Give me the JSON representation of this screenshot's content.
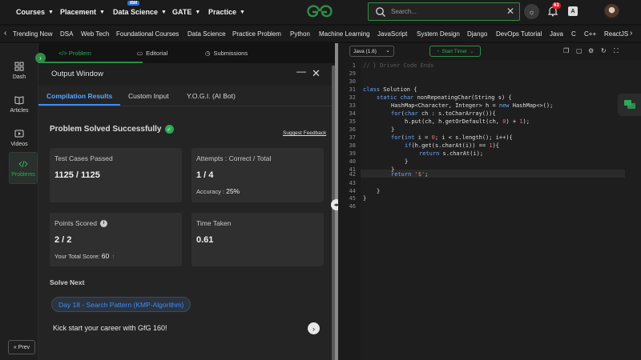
{
  "topnav": {
    "items": [
      {
        "label": "Courses"
      },
      {
        "label": "Placement"
      },
      {
        "label": "Data Science",
        "badge": "IBM"
      },
      {
        "label": "GATE"
      },
      {
        "label": "Practice"
      }
    ],
    "search_placeholder": "Search...",
    "notification_count": "63"
  },
  "subnav": {
    "items": [
      "Trending Now",
      "DSA",
      "Web Tech",
      "Foundational Courses",
      "Data Science",
      "Practice Problem",
      "Python",
      "Machine Learning",
      "JavaScript",
      "System Design",
      "Django",
      "DevOps Tutorial",
      "Java",
      "C",
      "C++",
      "ReactJS"
    ]
  },
  "sidebar": {
    "items": [
      {
        "label": "Dash"
      },
      {
        "label": "Articles"
      },
      {
        "label": "Videos"
      },
      {
        "label": "Problems",
        "active": true
      }
    ],
    "prev_label": "« Prev"
  },
  "problem_tabs": {
    "problem": "</> Problem",
    "editorial": "Editorial",
    "submissions": "Submissions"
  },
  "output": {
    "title": "Output Window",
    "tabs": [
      "Compilation Results",
      "Custom Input",
      "Y.O.G.I. (AI Bot)"
    ],
    "status": "Problem Solved Successfully",
    "feedback": "Suggest Feedback",
    "cards": {
      "test_cases": {
        "label": "Test Cases Passed",
        "value": "1125 / 1125"
      },
      "attempts": {
        "label": "Attempts : Correct / Total",
        "value": "1 / 4",
        "sub_label": "Accuracy : ",
        "sub_value": "25%"
      },
      "points": {
        "label": "Points Scored",
        "value": "2 / 2",
        "sub_label": "Your Total Score: ",
        "sub_value": "60"
      },
      "time": {
        "label": "Time Taken",
        "value": "0.61"
      }
    },
    "solve_next_title": "Solve Next",
    "solve_next_item": "Day 18 - Search Pattern (KMP-Algorithm)",
    "promo": "Kick start your career with GfG 160!"
  },
  "editor": {
    "language": "Java (1.8)",
    "timer": "Start Timer",
    "line_numbers": [
      "1",
      "29",
      "30",
      "31",
      "32",
      "33",
      "34",
      "35",
      "36",
      "37",
      "38",
      "39",
      "40",
      "41",
      "42",
      "43",
      "44",
      "45",
      "46"
    ],
    "code": {
      "l1": "// } Driver Code Ends",
      "l31a": "class",
      "l31b": " Solution {",
      "l32a": "static",
      "l32b": " char",
      "l32c": " nonRepeatingChar(String s) {",
      "l33a": "HashMap<Character, Integer>",
      "l33b": " h = ",
      "l33c": "new",
      "l33d": " HashMap<>();",
      "l34a": "for",
      "l34b": "(",
      "l34c": "char",
      "l34d": " ch : s.toCharArray()){",
      "l35a": "h.put(ch, h.getOrDefault(ch, ",
      "l35b": "0",
      "l35c": ") + ",
      "l35d": "1",
      "l35e": ");",
      "l36": "}",
      "l37a": "for",
      "l37b": "(",
      "l37c": "int",
      "l37d": " i = ",
      "l37e": "0",
      "l37f": "; i < s.length(); i++){",
      "l38a": "if",
      "l38b": "(h.get(s.charAt(i)) == ",
      "l38c": "1",
      "l38d": "){",
      "l39a": "return",
      "l39b": " s.charAt(i);",
      "l40": "}",
      "l41": "}",
      "l42a": "return",
      "l42b": " ",
      "l42c": "'$'",
      "l42d": ";",
      "l44": "}",
      "l45": "}"
    }
  }
}
